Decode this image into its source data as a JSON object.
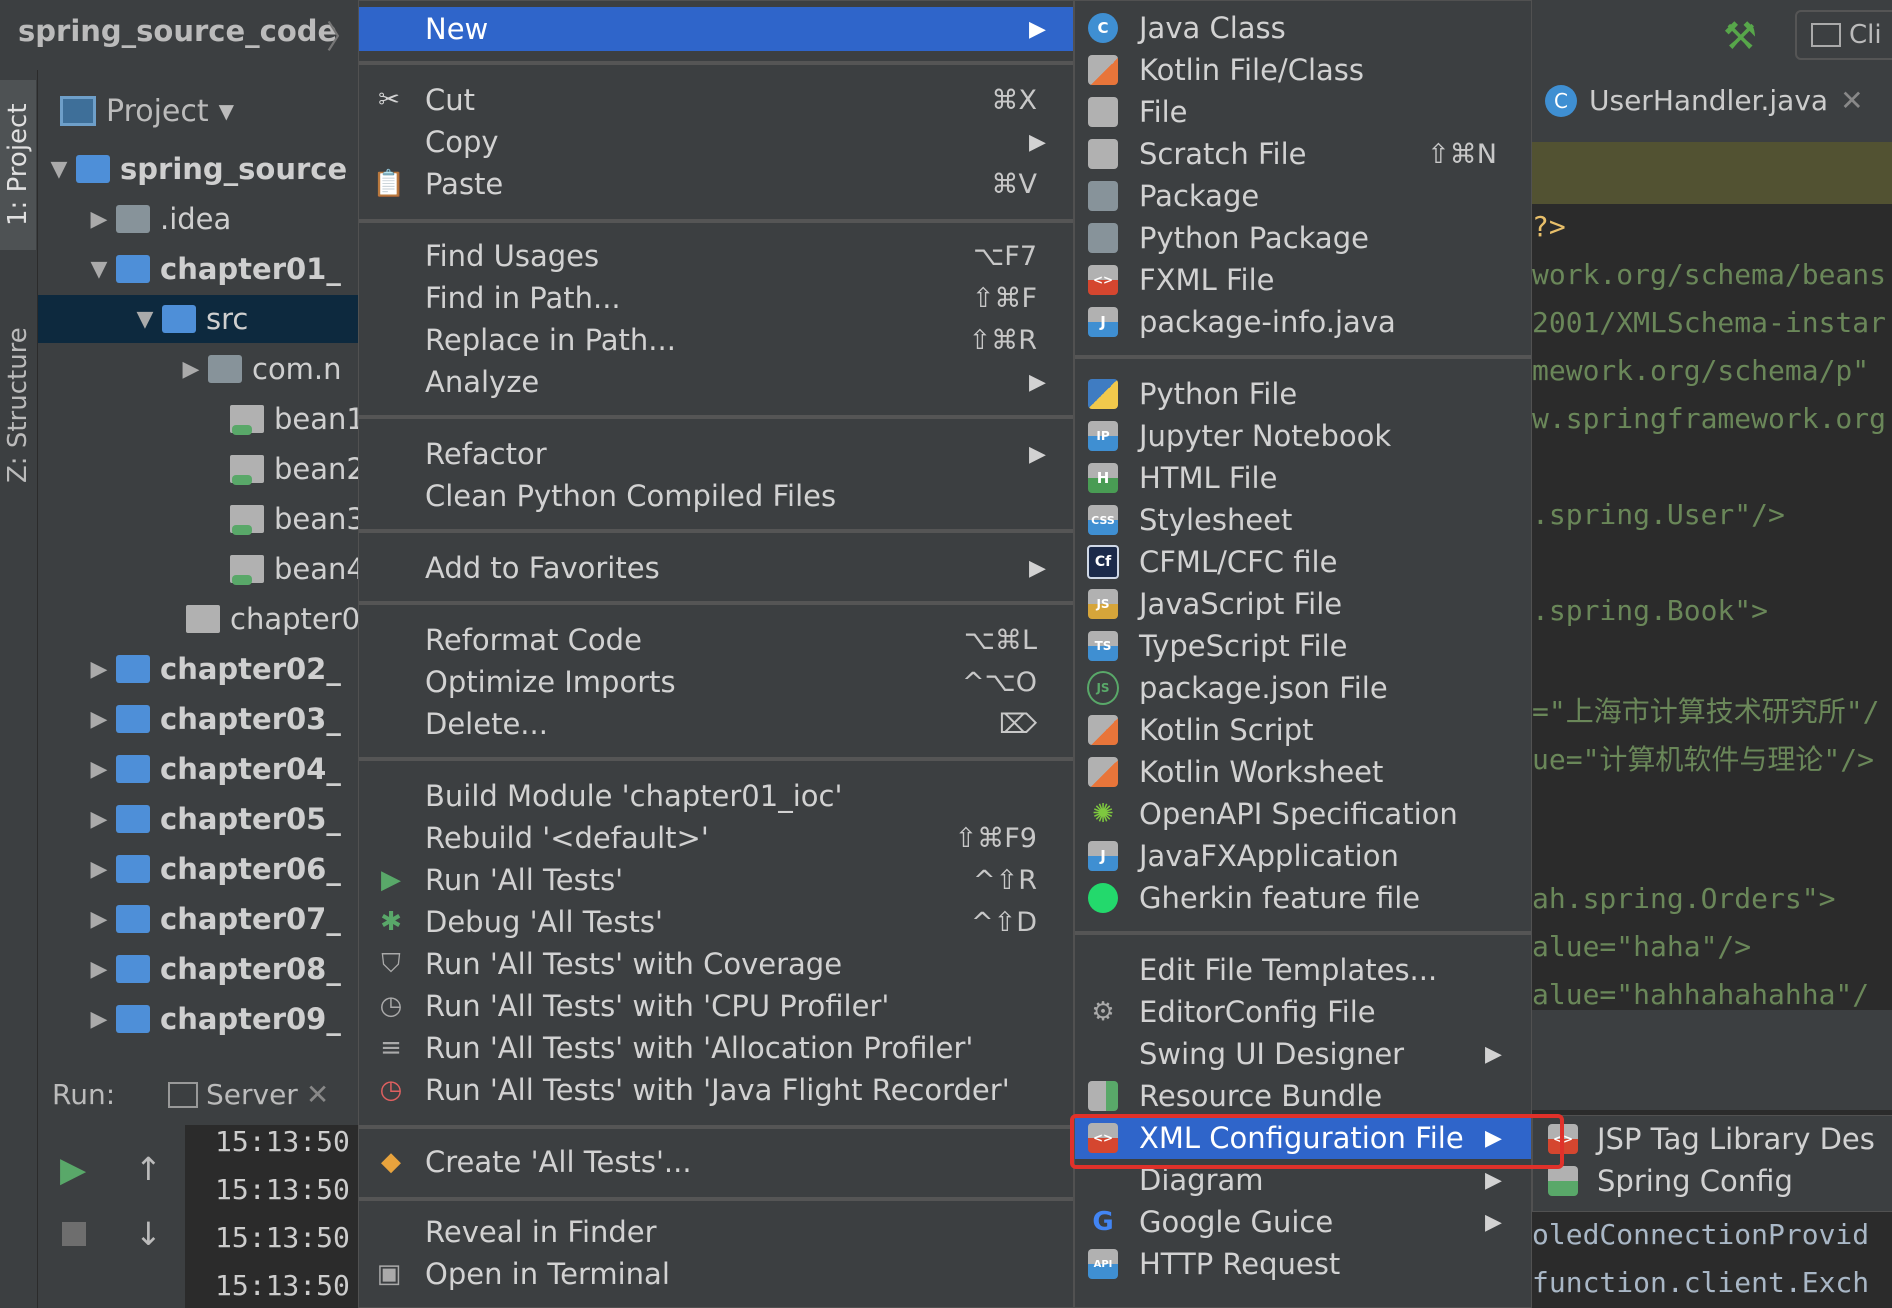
{
  "breadcrumb": {
    "project": "spring_source_code",
    "sep": "〉"
  },
  "toolbar": {
    "run_config": "Cli"
  },
  "tool_strip": {
    "project_tab": "1: Project",
    "structure_tab": "Z: Structure"
  },
  "project_panel": {
    "header": "Project",
    "tree": [
      {
        "label": "spring_source",
        "bold": true
      },
      {
        "label": ".idea"
      },
      {
        "label": "chapter01_",
        "bold": true
      },
      {
        "label": "src"
      },
      {
        "label": "com.n"
      },
      {
        "label": "bean1"
      },
      {
        "label": "bean2"
      },
      {
        "label": "bean3"
      },
      {
        "label": "bean4"
      },
      {
        "label": "chapter0"
      },
      {
        "label": "chapter02_",
        "bold": true
      },
      {
        "label": "chapter03_",
        "bold": true
      },
      {
        "label": "chapter04_",
        "bold": true
      },
      {
        "label": "chapter05_",
        "bold": true
      },
      {
        "label": "chapter06_",
        "bold": true
      },
      {
        "label": "chapter07_",
        "bold": true
      },
      {
        "label": "chapter08_",
        "bold": true
      },
      {
        "label": "chapter09_",
        "bold": true
      }
    ]
  },
  "run_panel": {
    "label": "Run:",
    "tab": "Server",
    "times": [
      "15:13:50",
      "15:13:50",
      "15:13:50",
      "15:13:50"
    ]
  },
  "editor": {
    "tab_label": "UserHandler.java",
    "tab_icon": "C",
    "lines": [
      "?>",
      "work.org/schema/beans",
      "2001/XMLSchema-instar",
      "mework.org/schema/p\"",
      "w.springframework.org",
      ".spring.User\"/>",
      ".spring.Book\">",
      "=\"上海市计算技术研究所\"/",
      "ue=\"计算机软件与理论\"/>",
      "ah.spring.Orders\">",
      "alue=\"haha\"/>",
      "alue=\"hahhahahahha\"/",
      "oledConnectionProvid",
      "function.client.Exch"
    ]
  },
  "context_menu": {
    "new": "New",
    "cut": {
      "label": "Cut",
      "shortcut": "⌘X"
    },
    "copy": "Copy",
    "paste": {
      "label": "Paste",
      "shortcut": "⌘V"
    },
    "find_usages": {
      "label": "Find Usages",
      "shortcut": "⌥F7"
    },
    "find_in_path": {
      "label": "Find in Path...",
      "shortcut": "⇧⌘F"
    },
    "replace_in_path": {
      "label": "Replace in Path...",
      "shortcut": "⇧⌘R"
    },
    "analyze": "Analyze",
    "refactor": "Refactor",
    "clean_python": "Clean Python Compiled Files",
    "add_favorites": "Add to Favorites",
    "reformat": {
      "label": "Reformat Code",
      "shortcut": "⌥⌘L"
    },
    "optimize": {
      "label": "Optimize Imports",
      "shortcut": "^⌥O"
    },
    "delete": {
      "label": "Delete...",
      "shortcut": "⌦"
    },
    "build_module": "Build Module 'chapter01_ioc'",
    "rebuild": {
      "label": "Rebuild '<default>'",
      "shortcut": "⇧⌘F9"
    },
    "run_tests": {
      "label": "Run 'All Tests'",
      "shortcut": "^⇧R"
    },
    "debug_tests": {
      "label": "Debug 'All Tests'",
      "shortcut": "^⇧D"
    },
    "run_coverage": "Run 'All Tests' with Coverage",
    "run_cpu": "Run 'All Tests' with 'CPU Profiler'",
    "run_alloc": "Run 'All Tests' with 'Allocation Profiler'",
    "run_jfr": "Run 'All Tests' with 'Java Flight Recorder'",
    "create_tests": "Create 'All Tests'...",
    "reveal_finder": "Reveal in Finder",
    "open_terminal": "Open in Terminal"
  },
  "new_submenu": {
    "java_class": "Java Class",
    "kotlin_file": "Kotlin File/Class",
    "file": "File",
    "scratch": {
      "label": "Scratch File",
      "shortcut": "⇧⌘N"
    },
    "package": "Package",
    "python_package": "Python Package",
    "fxml": "FXML File",
    "package_info": "package-info.java",
    "python_file": "Python File",
    "jupyter": "Jupyter Notebook",
    "html": "HTML File",
    "stylesheet": "Stylesheet",
    "cfml": "CFML/CFC file",
    "javascript": "JavaScript File",
    "typescript": "TypeScript File",
    "package_json": "package.json File",
    "kotlin_script": "Kotlin Script",
    "kotlin_worksheet": "Kotlin Worksheet",
    "openapi": "OpenAPI Specification",
    "javafx": "JavaFXApplication",
    "gherkin": "Gherkin feature file",
    "edit_templates": "Edit File Templates...",
    "editorconfig": "EditorConfig File",
    "swing": "Swing UI Designer",
    "resource_bundle": "Resource Bundle",
    "xml_config": "XML Configuration File",
    "diagram": "Diagram",
    "google_guice": "Google Guice",
    "http_request": "HTTP Request"
  },
  "xml_submenu": {
    "jsp_tag": "JSP Tag Library Des",
    "spring_config": "Spring Config"
  },
  "icon_labels": {
    "ip": "IP",
    "h": "H",
    "css": "CSS",
    "cf": "Cf",
    "js": "JS",
    "ts": "TS",
    "j": "J",
    "api": "API",
    "c": "C"
  },
  "colors": {
    "highlight": "#2f65ca",
    "annotation_box": "#e0312a"
  }
}
